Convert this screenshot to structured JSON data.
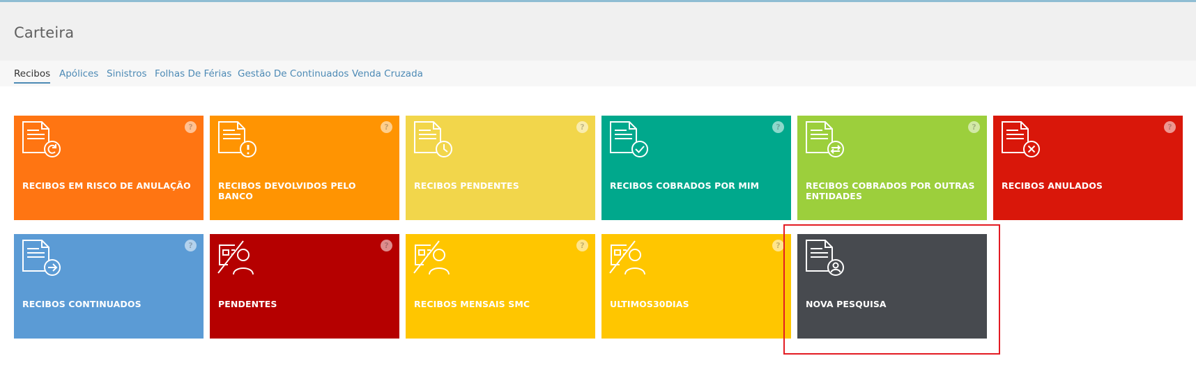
{
  "header": {
    "title": "Carteira"
  },
  "tabs": [
    {
      "label": "Recibos",
      "active": true
    },
    {
      "label": "Apólices"
    },
    {
      "label": "Sinistros"
    },
    {
      "label": "Folhas De Férias"
    },
    {
      "label": "Gestão De Continuados"
    },
    {
      "label": "Venda Cruzada"
    }
  ],
  "tiles": [
    {
      "label": "RECIBOS EM RISCO DE ANULAÇÃO",
      "color": "#ff7512",
      "icon": "document-refresh-icon"
    },
    {
      "label": "RECIBOS DEVOLVIDOS PELO BANCO",
      "color": "#ff9402",
      "icon": "document-alert-icon"
    },
    {
      "label": "RECIBOS PENDENTES",
      "color": "#f2d64b",
      "icon": "document-clock-icon"
    },
    {
      "label": "RECIBOS COBRADOS POR MIM",
      "color": "#00a88c",
      "icon": "document-check-icon"
    },
    {
      "label": "RECIBOS COBRADOS POR OUTRAS ENTIDADES",
      "color": "#9ccf3c",
      "icon": "document-exchange-icon"
    },
    {
      "label": "RECIBOS ANULADOS",
      "color": "#d9170a",
      "icon": "document-cancel-icon"
    },
    {
      "label": "RECIBOS CONTINUADOS",
      "color": "#5b9bd5",
      "icon": "document-arrow-icon"
    },
    {
      "label": "PENDENTES",
      "color": "#b50000",
      "icon": "id-card-person-icon"
    },
    {
      "label": "RECIBOS MENSAIS SMC",
      "color": "#ffc600",
      "icon": "id-card-person-icon"
    },
    {
      "label": "ULTIMOS30DIAS",
      "color": "#ffc600",
      "icon": "id-card-person-icon"
    },
    {
      "label": "NOVA PESQUISA",
      "color": "#474a4f",
      "icon": "document-user-icon"
    }
  ],
  "help_glyph": "?"
}
